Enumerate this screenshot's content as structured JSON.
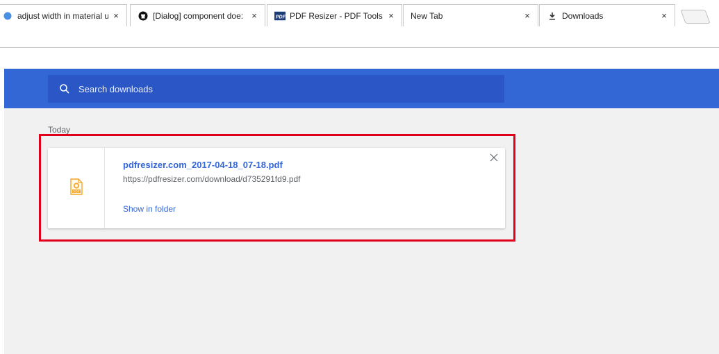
{
  "tabs": [
    {
      "title": "adjust width in material u",
      "close": "×",
      "icon": "chrome-icon"
    },
    {
      "title": "[Dialog] component doe:",
      "close": "×",
      "icon": "github-icon"
    },
    {
      "title": "PDF Resizer - PDF Tools",
      "close": "×",
      "icon": "pdf-resizer-icon"
    },
    {
      "title": "New Tab",
      "close": "×",
      "icon": "none"
    },
    {
      "title": "Downloads",
      "close": "×",
      "icon": "download-icon",
      "active": true
    }
  ],
  "search": {
    "placeholder": "Search downloads"
  },
  "downloads": {
    "day_label": "Today",
    "items": [
      {
        "file_name": "pdfresizer.com_2017-04-18_07-18.pdf",
        "url": "https://pdfresizer.com/download/d735291fd9.pdf",
        "action_label": "Show in folder",
        "icon": "pdf-file-icon",
        "icon_badge": "PDF"
      }
    ]
  },
  "colors": {
    "header": "#3367d6",
    "search_box": "#2a56c6",
    "link": "#3367d6",
    "highlight": "#e0001b",
    "pdf_icon": "#f5a623"
  }
}
